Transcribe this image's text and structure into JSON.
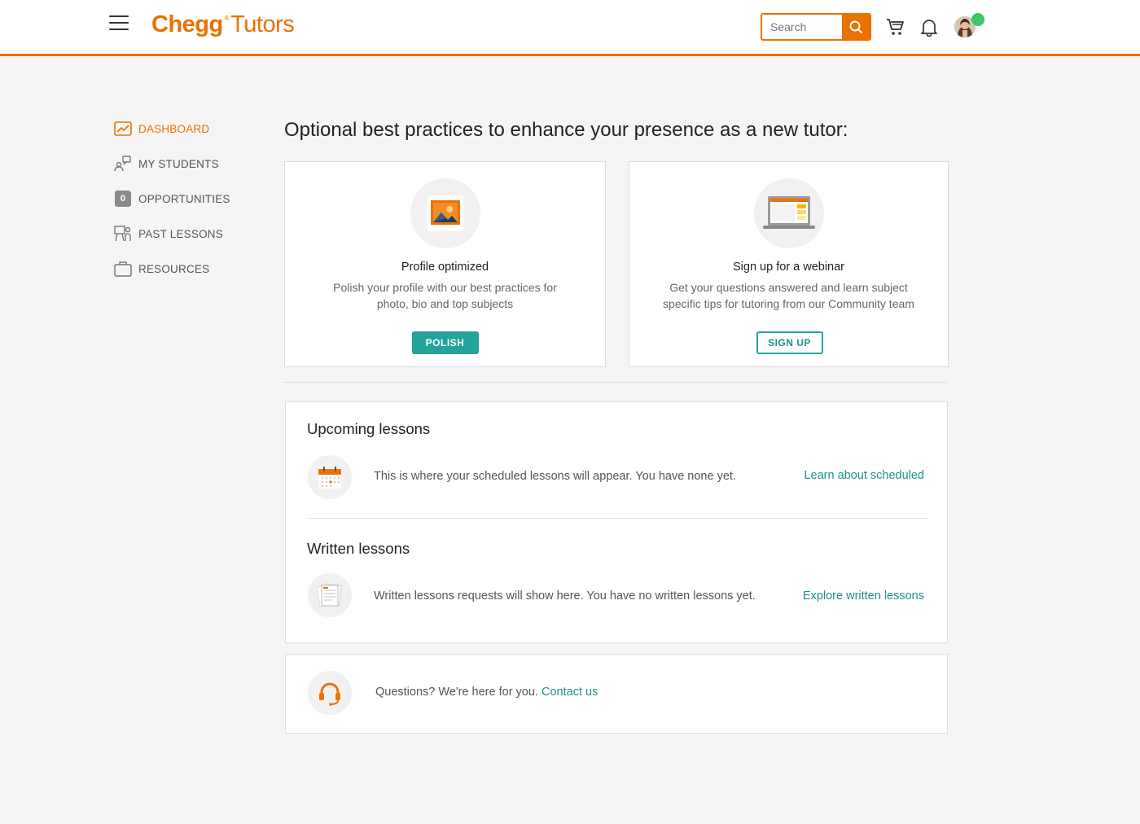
{
  "header": {
    "logo_main": "Chegg",
    "logo_tm": "®",
    "logo_sub": "Tutors",
    "search_placeholder": "Search",
    "accent": "#eb7100"
  },
  "sidebar": {
    "items": [
      {
        "label": "DASHBOARD",
        "icon": "dashboard-chart-icon",
        "active": true
      },
      {
        "label": "MY STUDENTS",
        "icon": "students-icon",
        "active": false
      },
      {
        "label": "OPPORTUNITIES",
        "icon": "count-badge",
        "badge": "0",
        "active": false
      },
      {
        "label": "PAST LESSONS",
        "icon": "past-lessons-icon",
        "active": false
      },
      {
        "label": "RESOURCES",
        "icon": "briefcase-icon",
        "active": false
      }
    ]
  },
  "main": {
    "title": "Optional best practices to enhance your presence as a new tutor:",
    "cards": [
      {
        "title": "Profile optimized",
        "desc": "Polish your profile with our best practices for photo, bio and top subjects",
        "button": "POLISH",
        "icon": "photo-icon"
      },
      {
        "title": "Sign up for a webinar",
        "desc": "Get your questions answered and learn subject specific tips for tutoring from our Community team",
        "button": "SIGN UP",
        "icon": "laptop-icon"
      }
    ],
    "upcoming": {
      "title": "Upcoming lessons",
      "text": "This is where your scheduled lessons will appear. You have none yet.",
      "link": "Learn about scheduled"
    },
    "written": {
      "title": "Written lessons",
      "text": "Written lessons requests will show here. You have no written lessons yet.",
      "link": "Explore written lessons"
    },
    "contact": {
      "text": "Questions? We're here for you.",
      "link": "Contact us"
    }
  },
  "colors": {
    "accent": "#eb7100",
    "teal": "#24a39d",
    "link": "#1f8f8a",
    "online": "#3fc56a"
  }
}
